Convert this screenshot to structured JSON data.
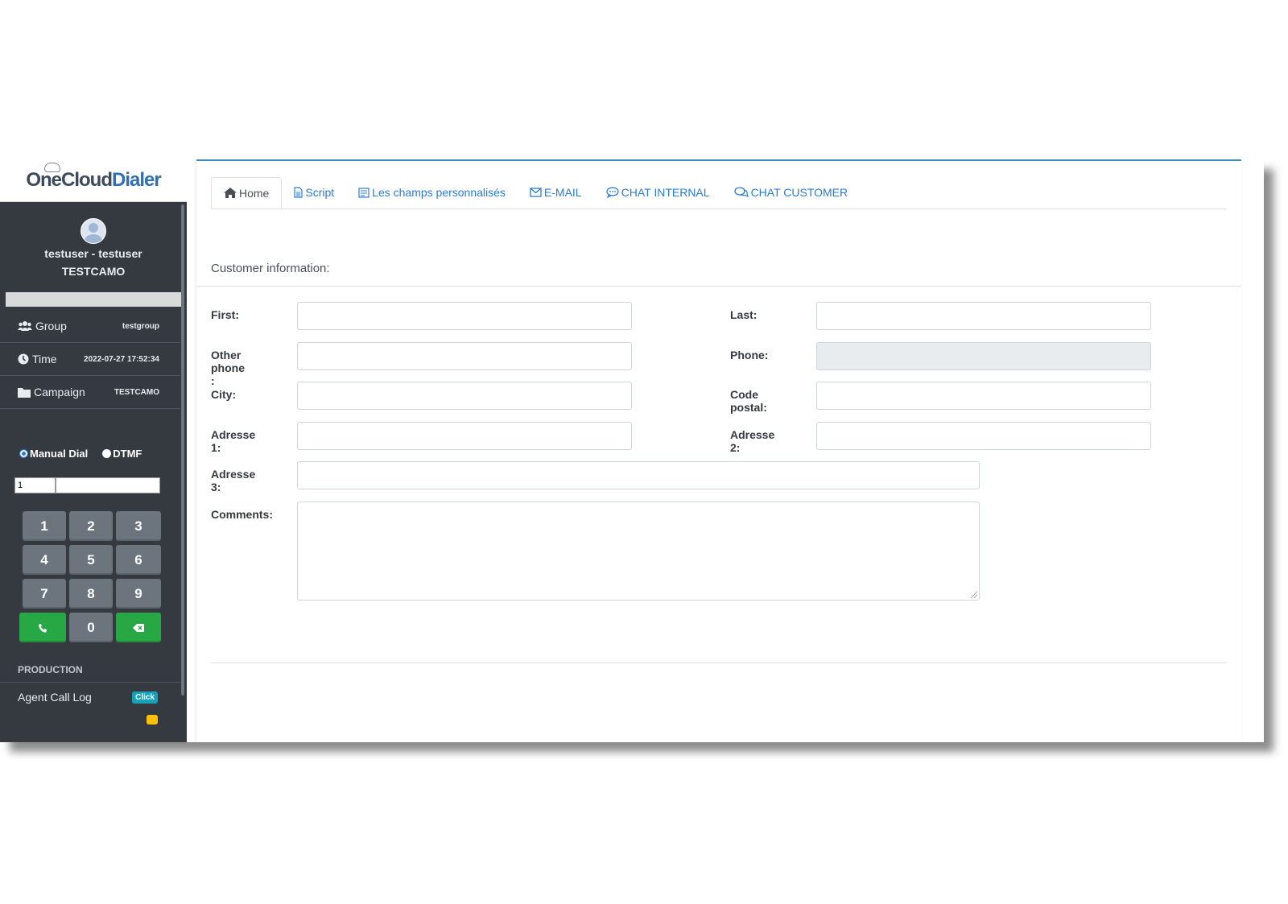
{
  "logo": {
    "part1": "One",
    "part2": "Cloud",
    "part3": "Dialer"
  },
  "user": {
    "name": "testuser - testuser",
    "campaign": "TESTCAMO"
  },
  "info": {
    "group_label": "Group",
    "group_value": "testgroup",
    "time_label": "Time",
    "time_value": "2022-07-27 17:52:34",
    "campaign_label": "Campaign",
    "campaign_value": "TESTCAMO"
  },
  "dial_mode": {
    "manual": "Manual Dial",
    "dtmf": "DTMF",
    "selected": "Manual Dial"
  },
  "dial_inputs": {
    "prefix_value": "1",
    "number_value": ""
  },
  "keypad": {
    "k1": "1",
    "k2": "2",
    "k3": "3",
    "k4": "4",
    "k5": "5",
    "k6": "6",
    "k7": "7",
    "k8": "8",
    "k9": "9",
    "k0": "0"
  },
  "nav": {
    "section": "PRODUCTION",
    "call_log": "Agent Call Log",
    "call_log_badge": "Click"
  },
  "tabs": {
    "home": "Home",
    "script": "Script",
    "custom": "Les champs personnalisés",
    "email": "E-MAIL",
    "chat_internal": "CHAT INTERNAL",
    "chat_customer": "CHAT CUSTOMER"
  },
  "form": {
    "title": "Customer information:",
    "first": "First:",
    "last": "Last:",
    "other_phone": "Other phone :",
    "phone": "Phone:",
    "city": "City:",
    "postal": "Code postal:",
    "addr1": "Adresse 1:",
    "addr2": "Adresse 2:",
    "addr3": "Adresse 3:",
    "comments": "Comments:"
  },
  "colors": {
    "sidebar_bg": "#343a40",
    "accent": "#3c8dbc",
    "link": "#2a7bd6",
    "green": "#28a745",
    "key_gray": "#6c757d"
  }
}
